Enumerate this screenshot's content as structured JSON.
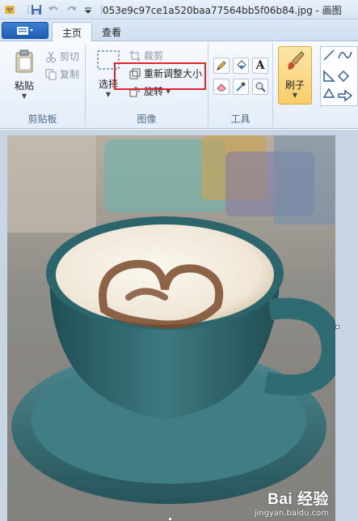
{
  "window": {
    "title": "053e9c97ce1a520baa77564bb5f06b84.jpg - 画图"
  },
  "tabs": [
    {
      "label": "主页",
      "active": true
    },
    {
      "label": "查看",
      "active": false
    }
  ],
  "clipboard": {
    "paste_label": "粘贴",
    "cut_label": "剪切",
    "copy_label": "复制",
    "group_label": "剪贴板"
  },
  "image": {
    "select_label": "选择",
    "crop_label": "裁剪",
    "resize_label": "重新调整大小",
    "rotate_label": "旋转",
    "group_label": "图像"
  },
  "tools": {
    "group_label": "工具",
    "items": [
      "pencil-icon",
      "fill-icon",
      "text-icon",
      "eraser-icon",
      "color-picker-icon",
      "magnifier-icon"
    ]
  },
  "brush": {
    "label": "刷子"
  },
  "watermark": {
    "main": "Bai 经验",
    "sub": "jingyan.baidu.com"
  },
  "colors": {
    "highlight": "#e3262c",
    "ribbon_accent": "#1d5db5",
    "brush_active": "#f8cd6a"
  }
}
